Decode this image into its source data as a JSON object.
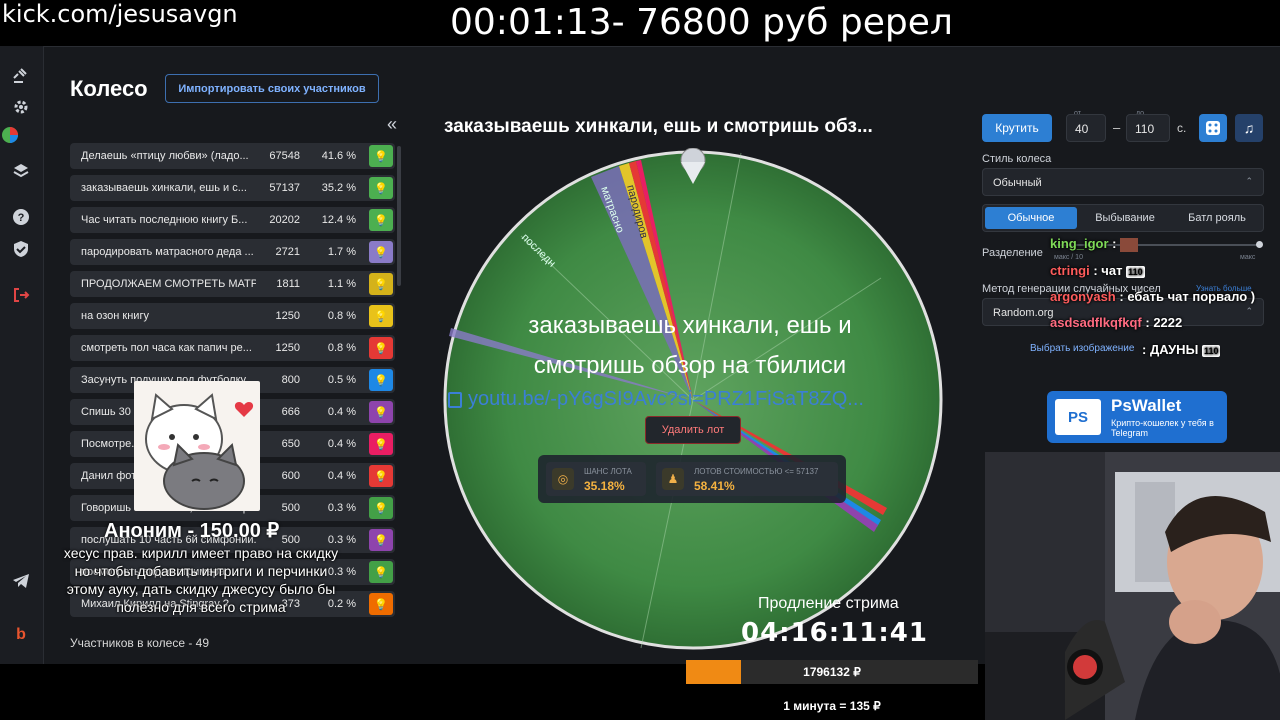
{
  "stream_overlay": {
    "url": "kick.com/jesusavgn",
    "title": "00:01:13- 76800 руб ререл"
  },
  "rail": {
    "icons": [
      "gavel-icon",
      "gear-icon",
      "pie-chart-icon",
      "layers-icon",
      "help-icon",
      "shield-icon",
      "logout-icon",
      "telegram-icon",
      "brand-icon"
    ]
  },
  "panel": {
    "title": "Колесо",
    "import_label": "Импортировать своих участников",
    "collapse_glyph": "«",
    "participants_count": "Участников в колесе - 49"
  },
  "participants": [
    {
      "name": "Делаешь «птицу любви» (ладо...",
      "amount": "67548",
      "percent": "41.6 %",
      "color": "#4caf50"
    },
    {
      "name": "заказываешь хинкали, ешь и с...",
      "amount": "57137",
      "percent": "35.2 %",
      "color": "#4caf50"
    },
    {
      "name": "Час читать последнюю книгу Б...",
      "amount": "20202",
      "percent": "12.4 %",
      "color": "#4caf50"
    },
    {
      "name": "пародировать матрасного деда ...",
      "amount": "2721",
      "percent": "1.7 %",
      "color": "#8a7bc8"
    },
    {
      "name": "ПРОДОЛЖАЕМ СМОТРЕТЬ МАТР...",
      "amount": "1811",
      "percent": "1.1 %",
      "color": "#d4b21a"
    },
    {
      "name": "на озон книгу",
      "amount": "1250",
      "percent": "0.8 %",
      "color": "#e8c21a"
    },
    {
      "name": "смотреть пол часа как папич ре...",
      "amount": "1250",
      "percent": "0.8 %",
      "color": "#e53935"
    },
    {
      "name": "Засунуть подушку под футболку...",
      "amount": "800",
      "percent": "0.5 %",
      "color": "#1e88e5"
    },
    {
      "name": "Спишь 30 ...",
      "amount": "666",
      "percent": "0.4 %",
      "color": "#8e44ad"
    },
    {
      "name": "Посмотре...",
      "amount": "650",
      "percent": "0.4 %",
      "color": "#e91e63"
    },
    {
      "name": "Данил фот...",
      "amount": "600",
      "percent": "0.4 %",
      "color": "#e53935"
    },
    {
      "name": "Говоришь слова тика, коль на пр...",
      "amount": "500",
      "percent": "0.3 %",
      "color": "#43a047"
    },
    {
      "name": "послушать 10 часть 6й симфонии...",
      "amount": "500",
      "percent": "0.3 %",
      "color": "#8e44ad"
    },
    {
      "name": "посмотреть видео стримера ...",
      "amount": "",
      "percent": "0.3 %",
      "color": "#43a047"
    },
    {
      "name": "Михаил Кирилл на Stingray ?",
      "amount": "373",
      "percent": "0.2 %",
      "color": "#ef6c00"
    }
  ],
  "donation": {
    "name": "Аноним - 150.00 ₽",
    "message": "хесус прав. кирилл имеет право на скидку но чтобы добавить интриги и перчинки этому ауку, дать скидку джесусу было бы полезно для всего стрима"
  },
  "wheel": {
    "title": "заказываешь хинкали, ешь и смотришь обз...",
    "big_text": "заказываешь хинкали, ешь и смотришь обзор на тбилиси",
    "link": "youtu.be/-pY6gSI9Avc?si=PRZ1FiSaT8ZQ...",
    "delete_label": "Удалить лот",
    "stat1_label": "ШАНС ЛОТА",
    "stat1_value": "35.18%",
    "stat2_label": "ЛОТОВ СТОИМОСТЬЮ <= 57137",
    "stat2_value": "58.41%",
    "slice_labels": [
      "матрасно",
      "пародиров",
      "последн"
    ],
    "extension_label": "Продление стрима",
    "extension_timer": "04:16:11:41"
  },
  "controls": {
    "spin_label": "Крутить",
    "from_label": "от",
    "to_label": "до",
    "from_value": "40",
    "to_value": "110",
    "dash": "–",
    "seconds": "с.",
    "style_label": "Стиль колеса",
    "style_value": "Обычный",
    "modes": [
      "Обычное",
      "Выбывание",
      "Батл рояль"
    ],
    "split_label": "Разделение",
    "split_max_left": "макс / 10",
    "split_max_right": "макс",
    "rng_label": "Метод генерации случайных чисел",
    "rng_more": "Узнать больше",
    "rng_value": "Random.org",
    "image_label": "Выбрать изображение"
  },
  "chat": [
    {
      "user": "king_igor",
      "text": ":",
      "color": "#7ed957"
    },
    {
      "user": "ctringi",
      "text": ": чат",
      "color": "#ff5c5c",
      "badge": "110"
    },
    {
      "user": "argonyash",
      "text": ": ебать чат порвало )",
      "color": "#ff5c5c"
    },
    {
      "user": "asdsadflkqfkqf",
      "text": ": 2222",
      "color": "#ff6b81"
    },
    {
      "user": "",
      "text": ": ДАУНЫ",
      "color": "#ff6b81",
      "badge": "110"
    }
  ],
  "ad": {
    "logo": "PS",
    "title": "PsWallet",
    "subtitle": "Крипто-кошелек у тебя в Telegram"
  },
  "goal": {
    "amount": "1796132 ₽",
    "progress": 0.19,
    "rate": "1 минута = 135 ₽"
  }
}
